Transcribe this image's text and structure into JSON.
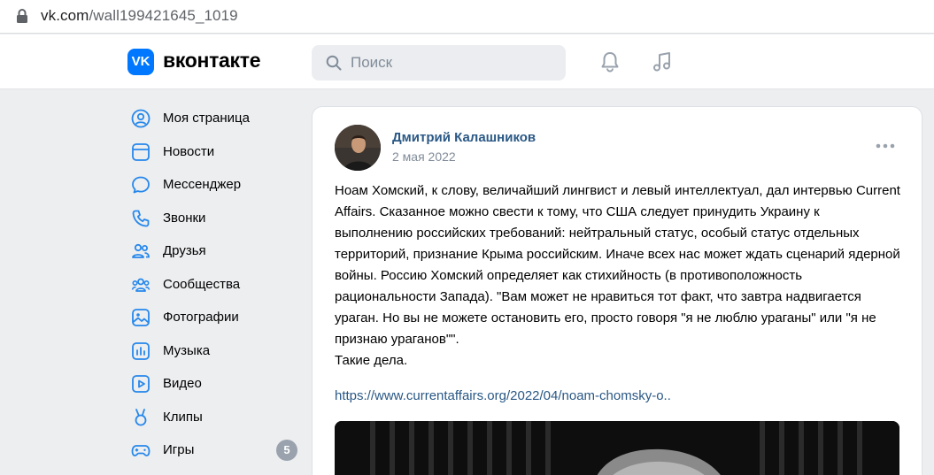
{
  "browser": {
    "url_host": "vk.com",
    "url_path": "/wall199421645_1019"
  },
  "header": {
    "logo_mark": "VK",
    "brand": "вконтакте",
    "search_placeholder": "Поиск",
    "icons": [
      "search-icon",
      "bell-icon",
      "music-note-icon"
    ]
  },
  "nav": {
    "items": [
      {
        "label": "Моя страница",
        "icon": "user-circle-icon"
      },
      {
        "label": "Новости",
        "icon": "news-icon"
      },
      {
        "label": "Мессенджер",
        "icon": "message-bubble-icon"
      },
      {
        "label": "Звонки",
        "icon": "phone-icon"
      },
      {
        "label": "Друзья",
        "icon": "friends-icon"
      },
      {
        "label": "Сообщества",
        "icon": "communities-icon"
      },
      {
        "label": "Фотографии",
        "icon": "photo-icon"
      },
      {
        "label": "Музыка",
        "icon": "music-icon"
      },
      {
        "label": "Видео",
        "icon": "video-icon"
      },
      {
        "label": "Клипы",
        "icon": "clips-icon"
      },
      {
        "label": "Игры",
        "icon": "gamepad-icon",
        "badge": "5"
      }
    ]
  },
  "post": {
    "author": "Дмитрий Калашников",
    "date": "2 мая 2022",
    "text": "Ноам Хомский, к слову, величайший лингвист и левый интеллектуал, дал интервью Current Affairs. Сказанное можно свести к тому, что США следует принудить Украину к выполнению российских требований: нейтральный статус, особый статус отдельных территорий, признание Крыма российским. Иначе всех нас может ждать сценарий ядерной войны. Россию Хомский определяет как стихийность (в противоположность рациональности Запада). \"Вам может не нравиться тот факт, что завтра надвигается ураган. Но вы не можете остановить его, просто говоря \"я не люблю ураганы\" или \"я не признаю ураганов\"\".",
    "text_tail": "Такие дела.",
    "link": "https://www.currentaffairs.org/2022/04/noam-chomsky-o.."
  },
  "colors": {
    "accent": "#0077ff",
    "link": "#2a5885",
    "muted": "#818c99",
    "page_bg": "#edeef0",
    "nav_icon": "#2688eb"
  }
}
